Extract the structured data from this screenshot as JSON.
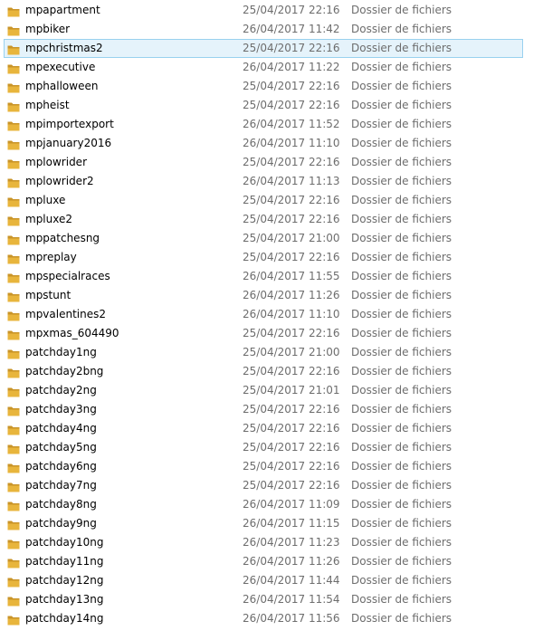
{
  "colors": {
    "folder": "#e8b53c",
    "folder_dark": "#c99428",
    "selection_bg": "#e5f3fb",
    "selection_border": "#99d1ef",
    "meta_text": "#6d6d6d"
  },
  "icon": "folder-icon",
  "rows": [
    {
      "name": "mpapartment",
      "date": "25/04/2017 22:16",
      "type": "Dossier de fichiers"
    },
    {
      "name": "mpbiker",
      "date": "26/04/2017 11:42",
      "type": "Dossier de fichiers"
    },
    {
      "name": "mpchristmas2",
      "date": "25/04/2017 22:16",
      "type": "Dossier de fichiers",
      "selected": true
    },
    {
      "name": "mpexecutive",
      "date": "26/04/2017 11:22",
      "type": "Dossier de fichiers"
    },
    {
      "name": "mphalloween",
      "date": "25/04/2017 22:16",
      "type": "Dossier de fichiers"
    },
    {
      "name": "mpheist",
      "date": "25/04/2017 22:16",
      "type": "Dossier de fichiers"
    },
    {
      "name": "mpimportexport",
      "date": "26/04/2017 11:52",
      "type": "Dossier de fichiers"
    },
    {
      "name": "mpjanuary2016",
      "date": "26/04/2017 11:10",
      "type": "Dossier de fichiers"
    },
    {
      "name": "mplowrider",
      "date": "25/04/2017 22:16",
      "type": "Dossier de fichiers"
    },
    {
      "name": "mplowrider2",
      "date": "26/04/2017 11:13",
      "type": "Dossier de fichiers"
    },
    {
      "name": "mpluxe",
      "date": "25/04/2017 22:16",
      "type": "Dossier de fichiers"
    },
    {
      "name": "mpluxe2",
      "date": "25/04/2017 22:16",
      "type": "Dossier de fichiers"
    },
    {
      "name": "mppatchesng",
      "date": "25/04/2017 21:00",
      "type": "Dossier de fichiers"
    },
    {
      "name": "mpreplay",
      "date": "25/04/2017 22:16",
      "type": "Dossier de fichiers"
    },
    {
      "name": "mpspecialraces",
      "date": "26/04/2017 11:55",
      "type": "Dossier de fichiers"
    },
    {
      "name": "mpstunt",
      "date": "26/04/2017 11:26",
      "type": "Dossier de fichiers"
    },
    {
      "name": "mpvalentines2",
      "date": "26/04/2017 11:10",
      "type": "Dossier de fichiers"
    },
    {
      "name": "mpxmas_604490",
      "date": "25/04/2017 22:16",
      "type": "Dossier de fichiers"
    },
    {
      "name": "patchday1ng",
      "date": "25/04/2017 21:00",
      "type": "Dossier de fichiers"
    },
    {
      "name": "patchday2bng",
      "date": "25/04/2017 22:16",
      "type": "Dossier de fichiers"
    },
    {
      "name": "patchday2ng",
      "date": "25/04/2017 21:01",
      "type": "Dossier de fichiers"
    },
    {
      "name": "patchday3ng",
      "date": "25/04/2017 22:16",
      "type": "Dossier de fichiers"
    },
    {
      "name": "patchday4ng",
      "date": "25/04/2017 22:16",
      "type": "Dossier de fichiers"
    },
    {
      "name": "patchday5ng",
      "date": "25/04/2017 22:16",
      "type": "Dossier de fichiers"
    },
    {
      "name": "patchday6ng",
      "date": "25/04/2017 22:16",
      "type": "Dossier de fichiers"
    },
    {
      "name": "patchday7ng",
      "date": "25/04/2017 22:16",
      "type": "Dossier de fichiers"
    },
    {
      "name": "patchday8ng",
      "date": "26/04/2017 11:09",
      "type": "Dossier de fichiers"
    },
    {
      "name": "patchday9ng",
      "date": "26/04/2017 11:15",
      "type": "Dossier de fichiers"
    },
    {
      "name": "patchday10ng",
      "date": "26/04/2017 11:23",
      "type": "Dossier de fichiers"
    },
    {
      "name": "patchday11ng",
      "date": "26/04/2017 11:26",
      "type": "Dossier de fichiers"
    },
    {
      "name": "patchday12ng",
      "date": "26/04/2017 11:44",
      "type": "Dossier de fichiers"
    },
    {
      "name": "patchday13ng",
      "date": "26/04/2017 11:54",
      "type": "Dossier de fichiers"
    },
    {
      "name": "patchday14ng",
      "date": "26/04/2017 11:56",
      "type": "Dossier de fichiers"
    }
  ]
}
